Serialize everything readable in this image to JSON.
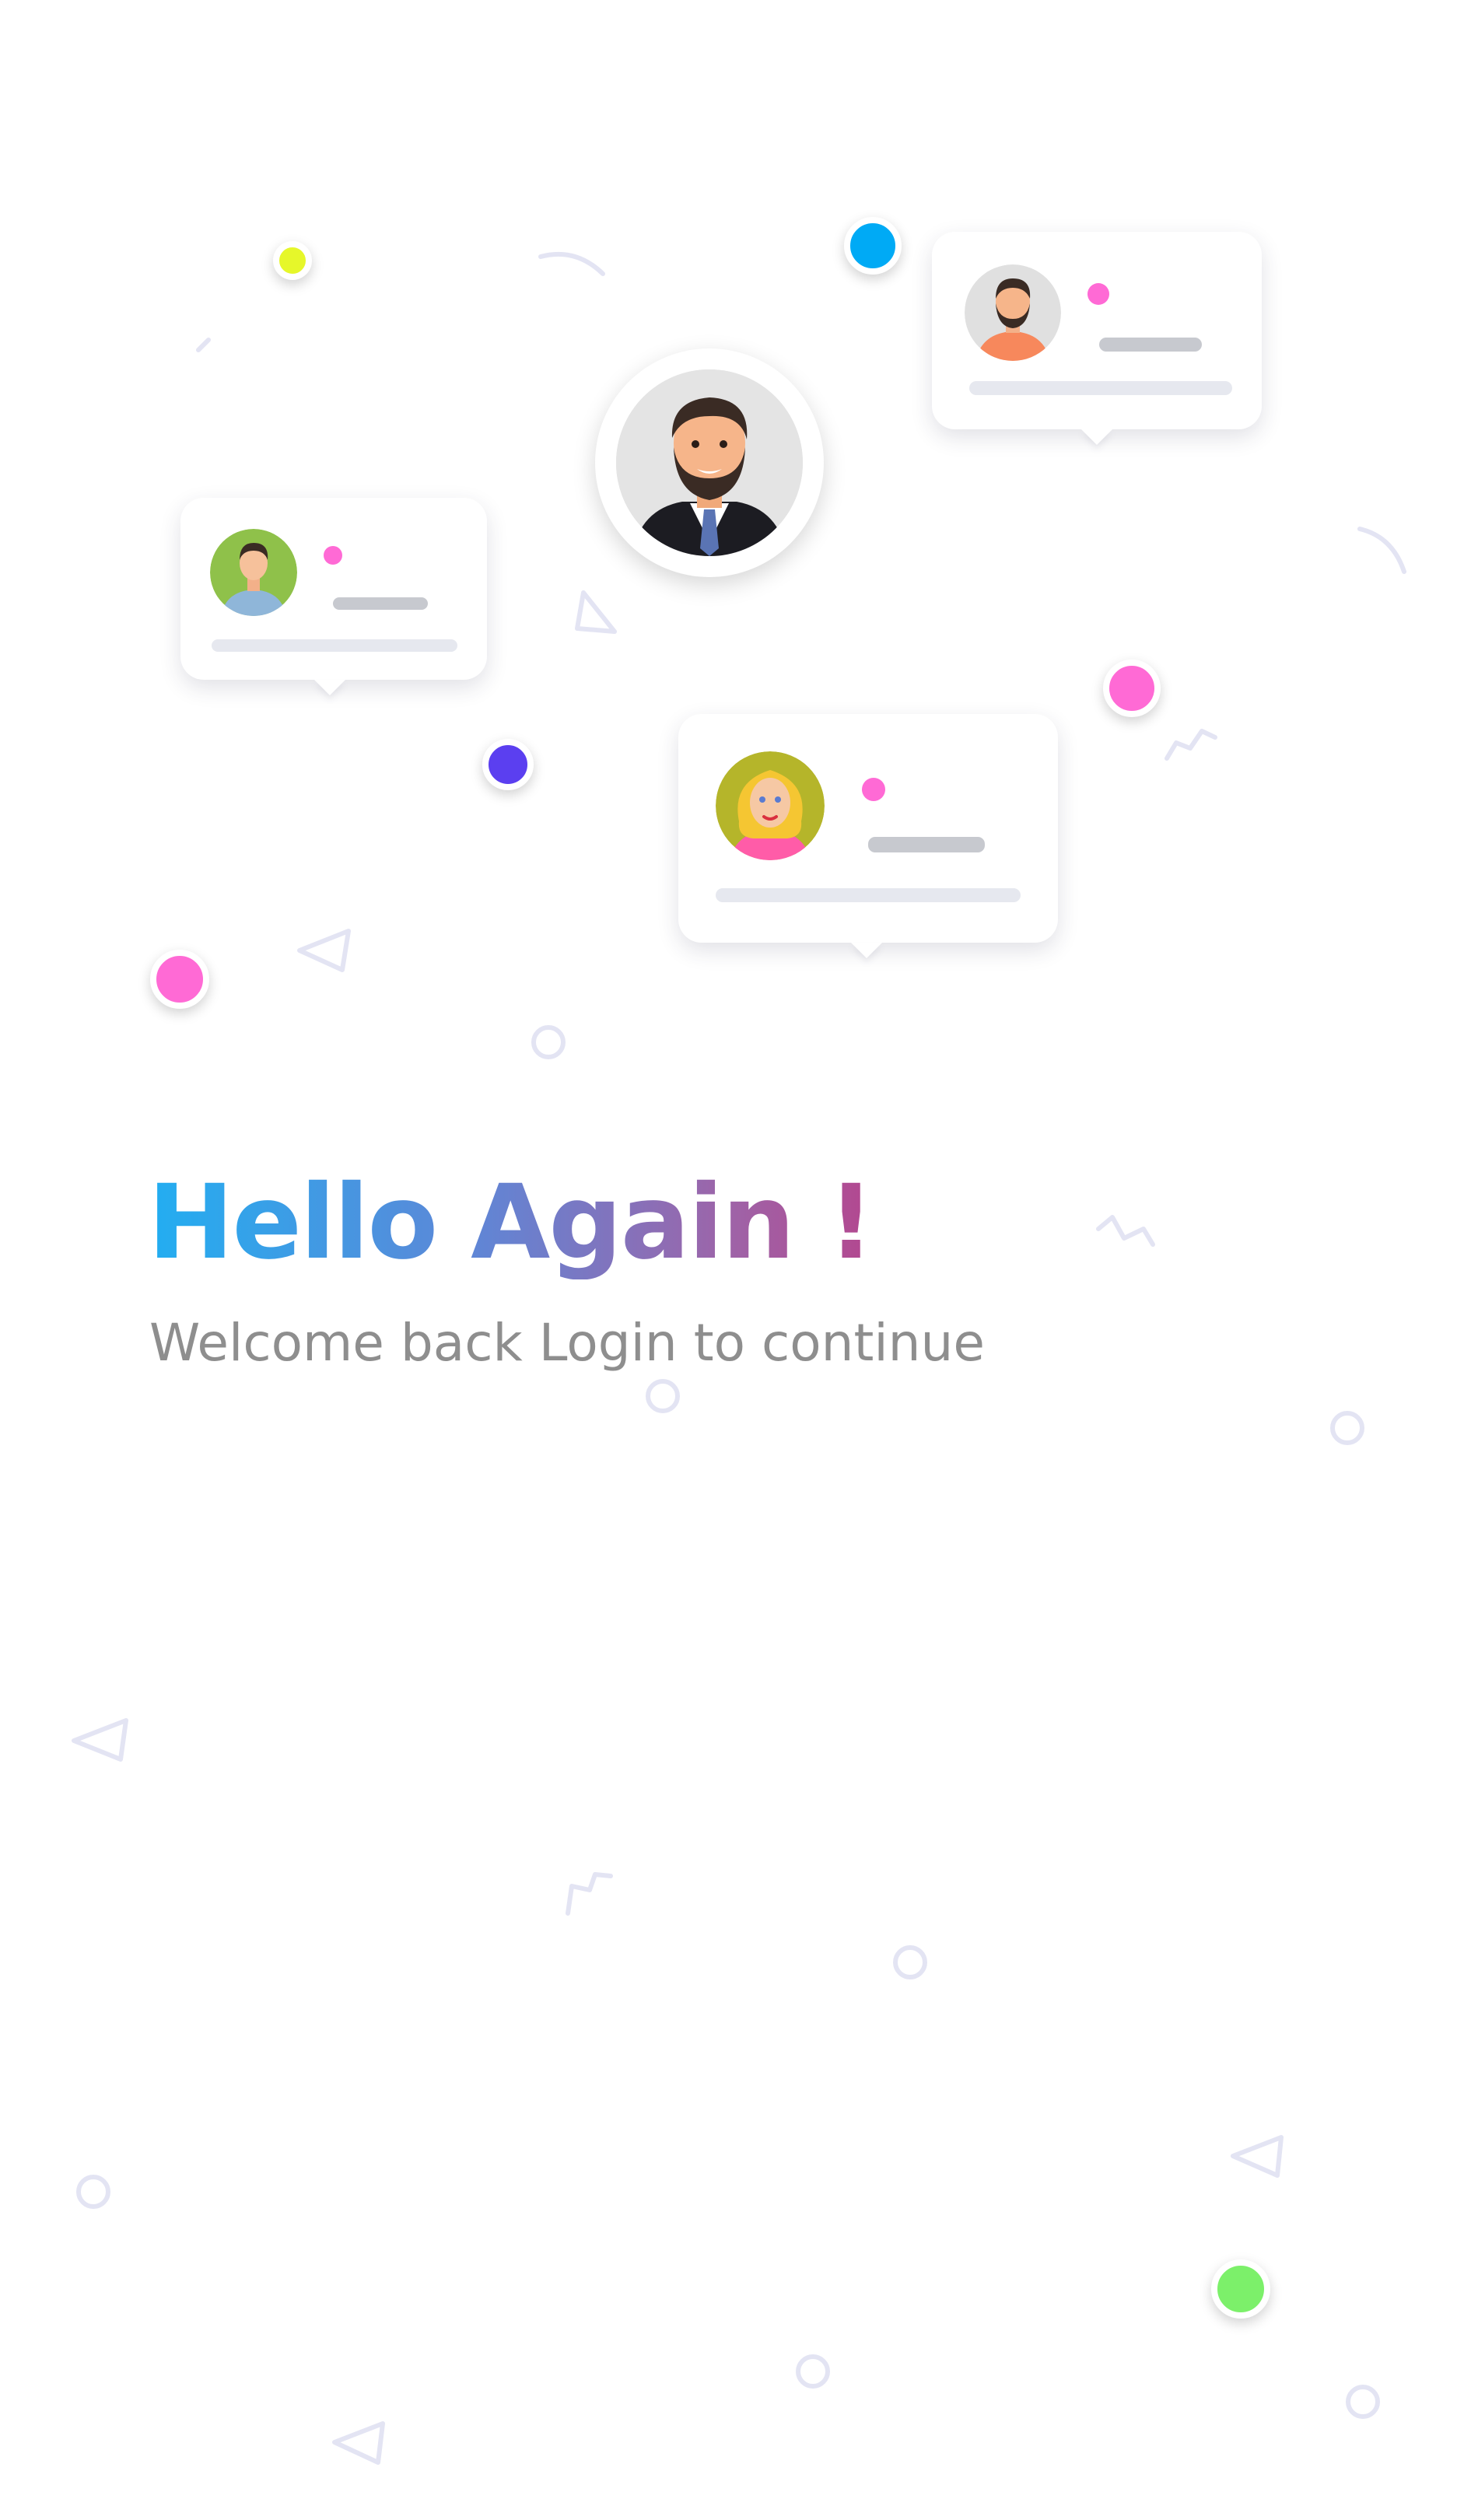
{
  "welcome": {
    "title": "Hello Again !",
    "subtitle": "Welcome back Login to continue"
  },
  "decor_colors": {
    "yellow": "#e6f72a",
    "blue": "#00aaf5",
    "purple": "#5b3ff0",
    "pink": "#ff6ad5",
    "green": "#7cf06a",
    "shape_stroke": "#e3e4f3"
  },
  "icons": [
    "avatar-man-beard-icon",
    "avatar-man-green-icon",
    "avatar-man-orange-icon",
    "avatar-woman-blonde-icon"
  ]
}
